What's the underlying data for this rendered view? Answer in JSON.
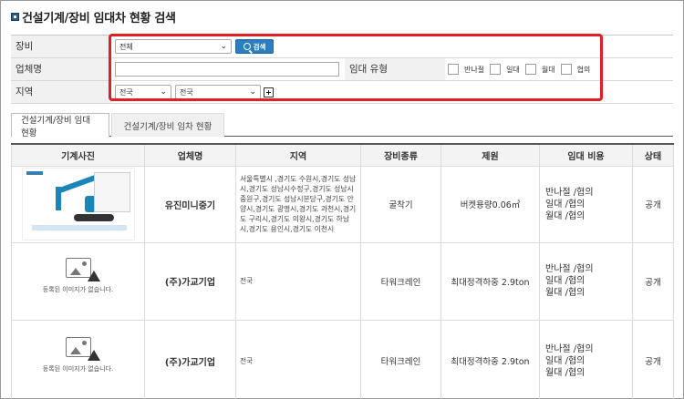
{
  "page": {
    "title": "건설기계/장비 임대차 현황 검색"
  },
  "search": {
    "equipment_label": "장비",
    "equipment_selected": "전체",
    "search_button": "검색",
    "company_label": "업체명",
    "company_value": "",
    "lease_type_label": "임대 유형",
    "lease_types": [
      "반나절",
      "일대",
      "월대",
      "협의"
    ],
    "region_label": "지역",
    "region1_selected": "전국",
    "region2_selected": "전국"
  },
  "tabs": [
    {
      "label": "건설기계/장비 임대 현황",
      "active": true
    },
    {
      "label": "건설기계/장비 임차 현황",
      "active": false
    }
  ],
  "table": {
    "columns": [
      "기계사진",
      "업체명",
      "지역",
      "장비종류",
      "제원",
      "임대 비용",
      "상태"
    ],
    "rows": [
      {
        "photo": "excavator-photo",
        "company": "유진미니중기",
        "region": "서울특별시 ,경기도 수원시,경기도 성남시,경기도 성남시수정구,경기도 성남시중원구,경기도 성남시분당구,경기도 안양시,경기도 광명시,경기도 과천시,경기도 구리시,경기도 의왕시,경기도 하남시,경기도 용인시,경기도 이천시",
        "equipment": "굴착기",
        "spec": "버켓용량0.06㎥",
        "cost": [
          "반나절 /협의",
          "일대 /협의",
          "월대 /협의"
        ],
        "status": "공개"
      },
      {
        "photo": "no-image",
        "noimage_text": "등록된 이미지가 없습니다.",
        "company": "(주)가교기업",
        "region": "전국",
        "equipment": "타워크레인",
        "spec": "최대정격하중 2.9ton",
        "cost": [
          "반나절 /협의",
          "일대 /협의",
          "월대 /협의"
        ],
        "status": "공개"
      },
      {
        "photo": "no-image",
        "noimage_text": "등록된 이미지가 없습니다.",
        "company": "(주)가교기업",
        "region": "전국",
        "equipment": "타워크레인",
        "spec": "최대정격하중 2.9ton",
        "cost": [
          "반나절 /협의",
          "일대 /협의",
          "월대 /협의"
        ],
        "status": "공개"
      }
    ]
  },
  "colors": {
    "highlight": "#e01f26",
    "search_button": "#2b7fc0",
    "title_icon": "#2d5a88"
  }
}
